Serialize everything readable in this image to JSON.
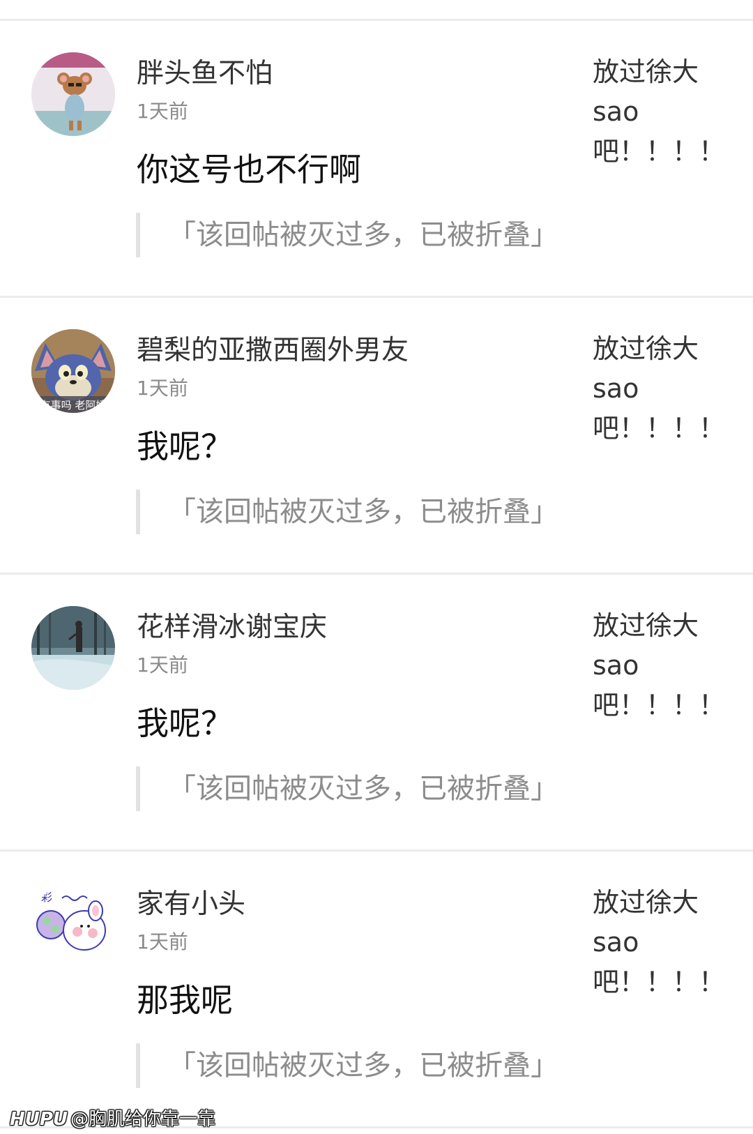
{
  "comments": [
    {
      "username": "胖头鱼不怕",
      "time": "1天前",
      "content": "你这号也不行啊",
      "folded_notice": "「该回帖被灭过多，已被折叠」",
      "quote": {
        "line1": "放过徐大",
        "line2": "sao",
        "line3": "吧！！！！"
      },
      "avatar_icon": "mouse-avatar-icon"
    },
    {
      "username": "碧梨的亚撒西圈外男友",
      "time": "1天前",
      "content": "我呢？",
      "folded_notice": "「该回帖被灭过多，已被折叠」",
      "quote": {
        "line1": "放过徐大",
        "line2": "sao",
        "line3": "吧！！！！"
      },
      "avatar_icon": "cat-avatar-icon",
      "avatar_caption": "有事吗 老阿姨"
    },
    {
      "username": "花样滑冰谢宝庆",
      "time": "1天前",
      "content": "我呢？",
      "folded_notice": "「该回帖被灭过多，已被折叠」",
      "quote": {
        "line1": "放过徐大",
        "line2": "sao",
        "line3": "吧！！！！"
      },
      "avatar_icon": "snowy-forest-avatar-icon"
    },
    {
      "username": "家有小头",
      "time": "1天前",
      "content": "那我呢",
      "folded_notice": "「该回帖被灭过多，已被折叠」",
      "quote": {
        "line1": "放过徐大",
        "line2": "sao",
        "line3": "吧！！！！"
      },
      "avatar_icon": "cartoon-bunny-avatar-icon"
    }
  ],
  "watermark": {
    "brand": "HUPU",
    "handle": "@胸肌给你靠一靠"
  },
  "colors": {
    "divider": "#ececec",
    "folded_text": "#8c8c8c",
    "time_text": "#8a8a8a"
  }
}
